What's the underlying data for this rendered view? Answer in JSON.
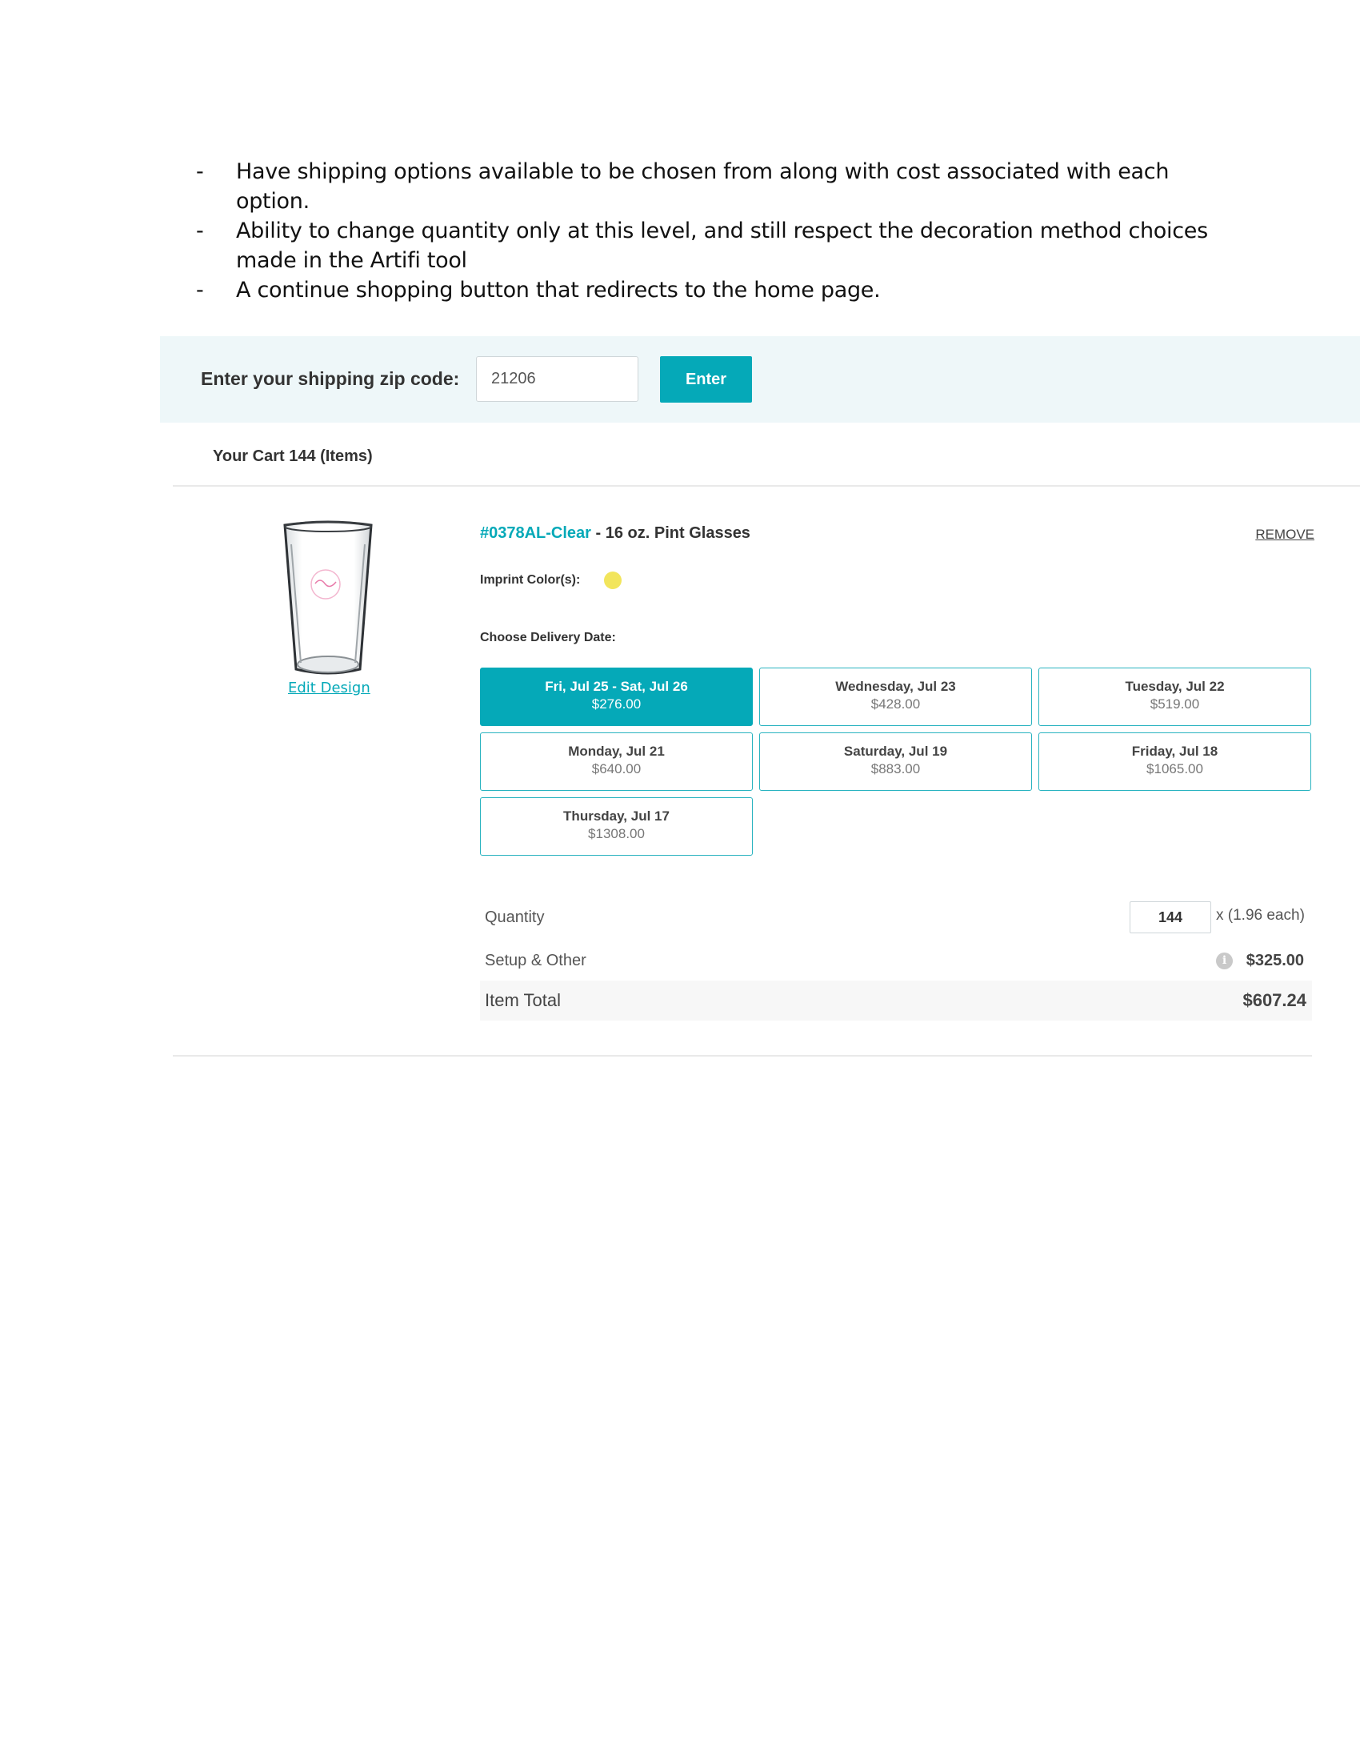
{
  "notes": [
    "Have shipping options available to be chosen from along with cost associated with each option.",
    "Ability to change quantity only at this level, and still respect the decoration method choices made in the Artifi tool",
    "A continue shopping button that redirects to the home page."
  ],
  "shipping": {
    "label": "Enter your shipping zip code:",
    "zip_value": "21206",
    "enter_label": "Enter"
  },
  "cart": {
    "heading": "Your Cart 144 (Items)"
  },
  "item": {
    "sku": "#0378AL-Clear",
    "title_rest": " - 16 oz. Pint Glasses",
    "remove_label": "REMOVE",
    "edit_label": "Edit Design",
    "imprint_label": "Imprint Color(s):",
    "imprint_color": "#f2e55c",
    "delivery_label": "Choose Delivery Date:",
    "delivery_options": [
      {
        "date": "Fri, Jul 25 - Sat, Jul 26",
        "price": "$276.00",
        "selected": true
      },
      {
        "date": "Wednesday, Jul 23",
        "price": "$428.00",
        "selected": false
      },
      {
        "date": "Tuesday, Jul 22",
        "price": "$519.00",
        "selected": false
      },
      {
        "date": "Monday, Jul 21",
        "price": "$640.00",
        "selected": false
      },
      {
        "date": "Saturday, Jul 19",
        "price": "$883.00",
        "selected": false
      },
      {
        "date": "Friday, Jul 18",
        "price": "$1065.00",
        "selected": false
      },
      {
        "date": "Thursday, Jul 17",
        "price": "$1308.00",
        "selected": false
      }
    ],
    "quantity_label": "Quantity",
    "quantity_value": "144",
    "each_label": "x (1.96 each)",
    "setup_label": "Setup & Other",
    "setup_value": "$325.00",
    "total_label": "Item Total",
    "total_value": "$607.24"
  },
  "colors": {
    "accent": "#05a9b8",
    "zip_bar_bg": "#eef7f9"
  }
}
